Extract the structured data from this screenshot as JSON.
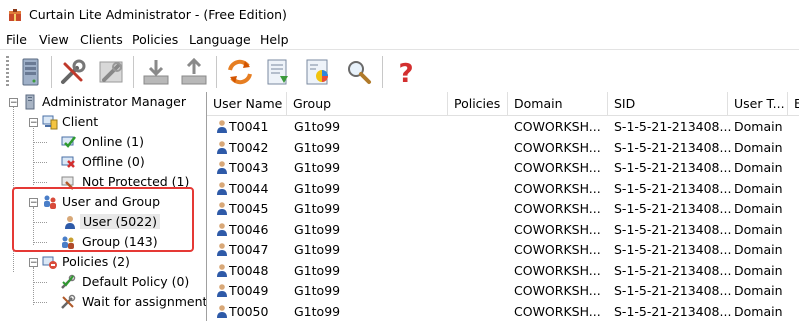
{
  "window": {
    "title": "Curtain Lite Administrator - (Free Edition)"
  },
  "menu": [
    "File",
    "View",
    "Clients",
    "Policies",
    "Language",
    "Help"
  ],
  "toolbar": {
    "buttons": [
      "server-icon",
      "tools-icon",
      "settings-icon",
      "import-icon",
      "export-icon",
      "refresh-icon",
      "document-icon",
      "report-icon",
      "search-icon",
      "help-icon"
    ]
  },
  "tree": {
    "root": "Administrator Manager",
    "client": "Client",
    "online": "Online (1)",
    "offline": "Offline (0)",
    "not_protected": "Not Protected (1)",
    "user_group": "User and Group",
    "user": "User (5022)",
    "group": "Group (143)",
    "policies": "Policies (2)",
    "default_policy": "Default Policy (0)",
    "wait_assignment": "Wait for assignment"
  },
  "table": {
    "columns": [
      "User Name",
      "Group",
      "Policies",
      "Domain",
      "SID",
      "User T...",
      "E"
    ],
    "rows": [
      [
        "T0041",
        "G1to99",
        "",
        "COWORKSH...",
        "S-1-5-21-213408...",
        "Domain"
      ],
      [
        "T0042",
        "G1to99",
        "",
        "COWORKSH...",
        "S-1-5-21-213408...",
        "Domain"
      ],
      [
        "T0043",
        "G1to99",
        "",
        "COWORKSH...",
        "S-1-5-21-213408...",
        "Domain"
      ],
      [
        "T0044",
        "G1to99",
        "",
        "COWORKSH...",
        "S-1-5-21-213408...",
        "Domain"
      ],
      [
        "T0045",
        "G1to99",
        "",
        "COWORKSH...",
        "S-1-5-21-213408...",
        "Domain"
      ],
      [
        "T0046",
        "G1to99",
        "",
        "COWORKSH...",
        "S-1-5-21-213408...",
        "Domain"
      ],
      [
        "T0047",
        "G1to99",
        "",
        "COWORKSH...",
        "S-1-5-21-213408...",
        "Domain"
      ],
      [
        "T0048",
        "G1to99",
        "",
        "COWORKSH...",
        "S-1-5-21-213408...",
        "Domain"
      ],
      [
        "T0049",
        "G1to99",
        "",
        "COWORKSH...",
        "S-1-5-21-213408...",
        "Domain"
      ],
      [
        "T0050",
        "G1to99",
        "",
        "COWORKSH...",
        "S-1-5-21-213408...",
        "Domain"
      ]
    ]
  },
  "colors": {
    "highlight": "#e53935",
    "selection": "#e8e8e8",
    "help": "#d32f2f"
  }
}
